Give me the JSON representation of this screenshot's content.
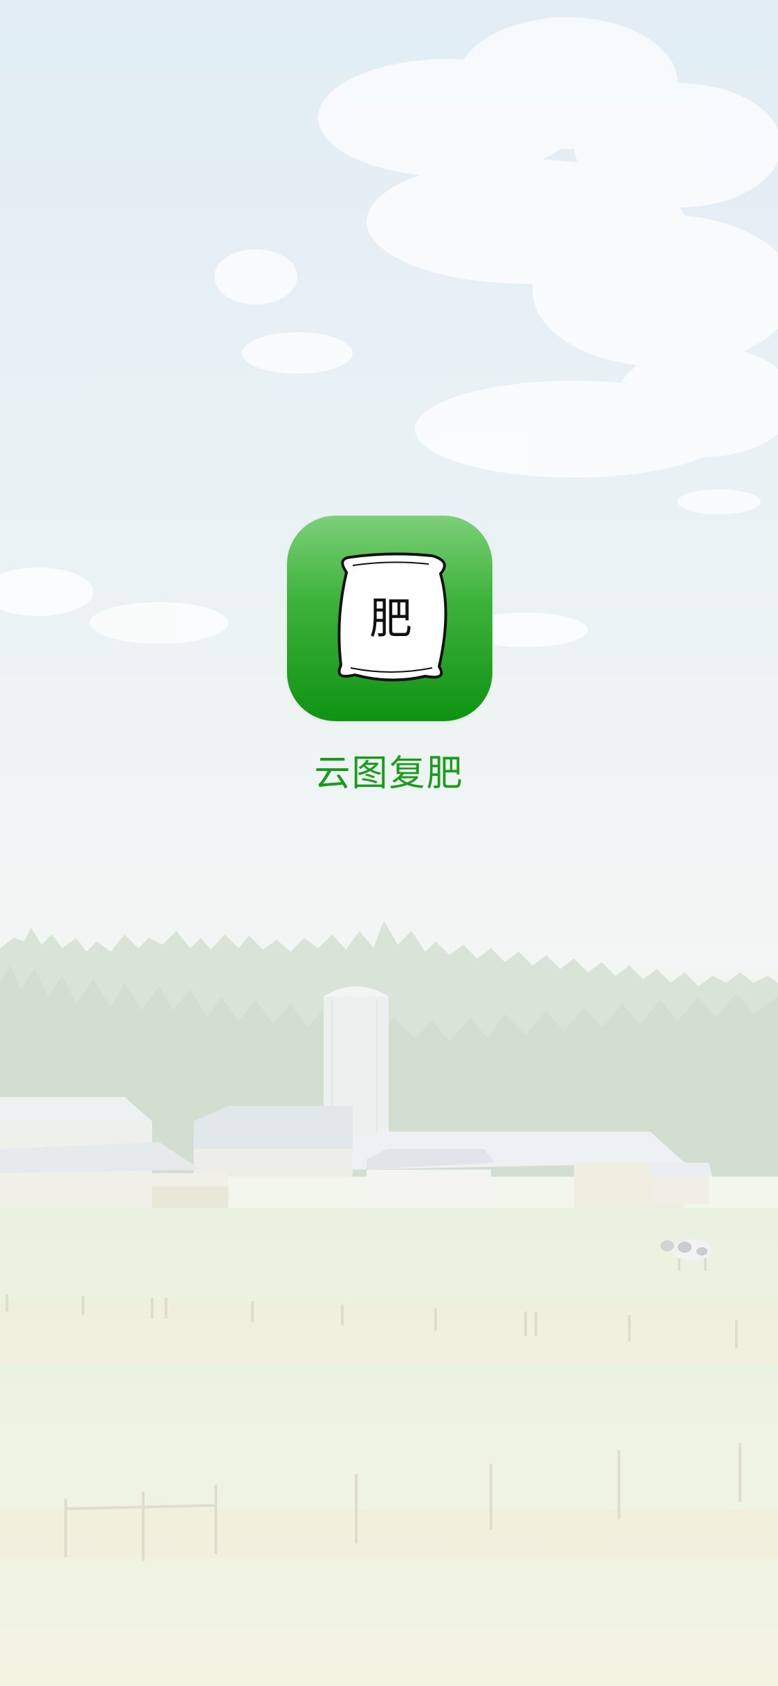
{
  "app": {
    "name": "云图复肥",
    "icon_glyph": "肥",
    "icon_name": "fertilizer-bag-icon"
  },
  "colors": {
    "brand_green": "#1b9a1b",
    "icon_gradient_top": "#7dd07a",
    "icon_gradient_bottom": "#0f9313"
  },
  "screen": {
    "type": "splash-screen",
    "background": "farm-landscape-illustration"
  }
}
